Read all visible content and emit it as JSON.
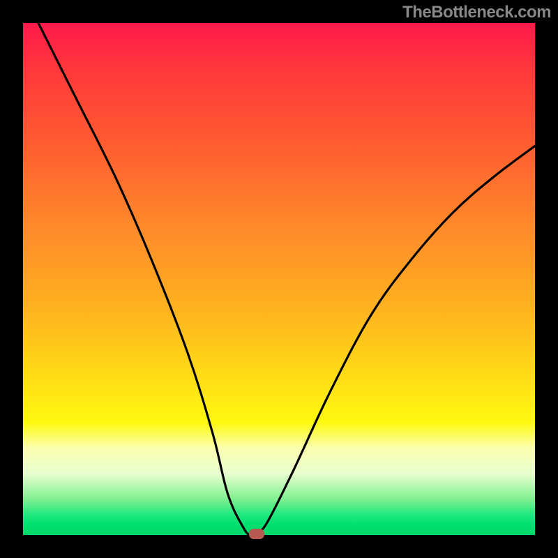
{
  "watermark": "TheBottleneck.com",
  "chart_data": {
    "type": "line",
    "title": "",
    "xlabel": "",
    "ylabel": "",
    "xlim": [
      0,
      100
    ],
    "ylim": [
      0,
      100
    ],
    "x": [
      3,
      10,
      18,
      25,
      32,
      37,
      40,
      43,
      44.5,
      46,
      48,
      53,
      60,
      68,
      76,
      84,
      92,
      100
    ],
    "values": [
      100,
      86,
      70,
      54,
      36,
      20,
      8,
      1.5,
      0,
      0.5,
      3,
      13,
      28,
      43,
      54,
      63,
      70,
      76
    ],
    "marker": {
      "x": 45.7,
      "y": 0
    },
    "background_gradient": {
      "top_color": "#ff1a4a",
      "bottom_color": "#00d868"
    }
  }
}
